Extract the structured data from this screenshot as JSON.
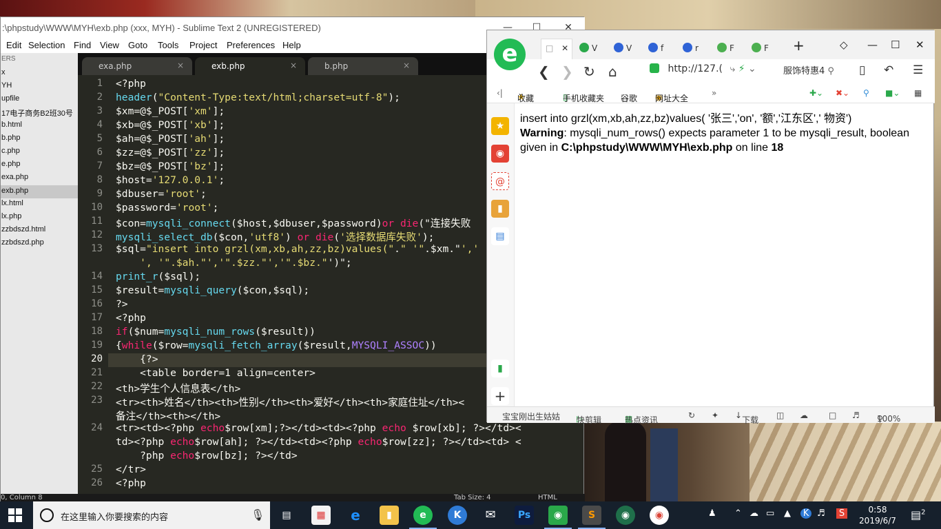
{
  "sublime": {
    "title": ":\\phpstudy\\WWW\\MYH\\exb.php (xxx, MYH) - Sublime Text 2 (UNREGISTERED)",
    "menu": [
      "Edit",
      "Selection",
      "Find",
      "View",
      "Goto",
      "Tools",
      "Project",
      "Preferences",
      "Help"
    ],
    "sidebar_header": "ERS",
    "sidebar": [
      "x",
      "YH",
      "upfile",
      "17电子商务B2班30号",
      "b.html",
      "b.php",
      "c.php",
      "e.php",
      "exa.php",
      "exb.php",
      "lx.html",
      "lx.php",
      "zzbdszd.html",
      "zzbdszd.php"
    ],
    "sidebar_selected": "exb.php",
    "tabs": [
      {
        "label": "exa.php",
        "close": "×"
      },
      {
        "label": "exb.php",
        "close": "×"
      },
      {
        "label": "b.php",
        "close": "×"
      }
    ],
    "line_numbers": [
      "1",
      "2",
      "3",
      "4",
      "5",
      "6",
      "7",
      "8",
      "9",
      "10",
      "11",
      "12",
      "13",
      "",
      "14",
      "15",
      "16",
      "17",
      "18",
      "19",
      "20",
      "21",
      "22",
      "23",
      "",
      "24",
      "",
      "",
      "25",
      "26"
    ],
    "current_line": "20",
    "status_left": "0, Column 8",
    "status_tab": "Tab Size: 4",
    "status_syntax": "HTML"
  },
  "code": [
    "<?php",
    "header(\"Content-Type:text/html;charset=utf-8\");",
    "$xm=@$_POST['xm'];",
    "$xb=@$_POST['xb'];",
    "$ah=@$_POST['ah'];",
    "$zz=@$_POST['zz'];",
    "$bz=@$_POST['bz'];",
    "$host='127.0.0.1';",
    "$dbuser='root';",
    "$password='root';",
    "$con=mysqli_connect($host,$dbuser,$password)or die(\"连接失败",
    "mysqli_select_db($con,'utf8') or die('选择数据库失败');",
    "$sql=\"insert into grzl(xm,xb,ah,zz,bz)values(\".\" '\".$xm.\"','",
    "    ', '\".$ah.\"','\".$zz.\"','\".$bz.\"')\";",
    "print_r($sql);",
    "$result=mysqli_query($con,$sql);",
    "?>",
    "<?php",
    "if($num=mysqli_num_rows($result))",
    "{while($row=mysqli_fetch_array($result,MYSQLI_ASSOC))",
    "    {?>",
    "    <table border=1 align=center>",
    "<th>学生个人信息表</th>",
    "<tr><th>姓名</th><th>性别</th><th>爱好</th><th>家庭住址</th><",
    "备注</th><th></th>",
    "<tr><td><?php echo$row[xm];?></td><td><?php echo $row[xb]; ?></td><",
    "td><?php echo$row[ah]; ?></td><td><?php echo$row[zz]; ?></td><td> <",
    "    ?php echo$row[bz]; ?></td>",
    "</tr>",
    "<?php"
  ],
  "browser": {
    "tabs": [
      "V",
      "f",
      "r",
      "F",
      "F"
    ],
    "address": "http://127.(",
    "search": "服饰特惠4",
    "favorites": [
      "收藏",
      "手机收藏夹",
      "谷歌",
      "网址大全"
    ],
    "output_line1": "insert into grzl(xm,xb,ah,zz,bz)values( '张三','on', '额','江东区',' 物资')",
    "warning_label": "Warning",
    "warning_text": ": mysqli_num_rows() expects parameter 1 to be mysqli_result, boolean given in ",
    "warning_path": "C:\\phpstudy\\WWW\\MYH\\exb.php",
    "warning_on": " on line ",
    "warning_line": "18",
    "status": [
      "宝宝刚出生姑姑",
      "快剪辑",
      "热点资讯",
      "下载",
      "100%"
    ]
  },
  "taskbar": {
    "search_placeholder": "在这里输入你要搜索的内容",
    "time": "0:58",
    "date": "2019/6/7",
    "notifications": "2"
  }
}
